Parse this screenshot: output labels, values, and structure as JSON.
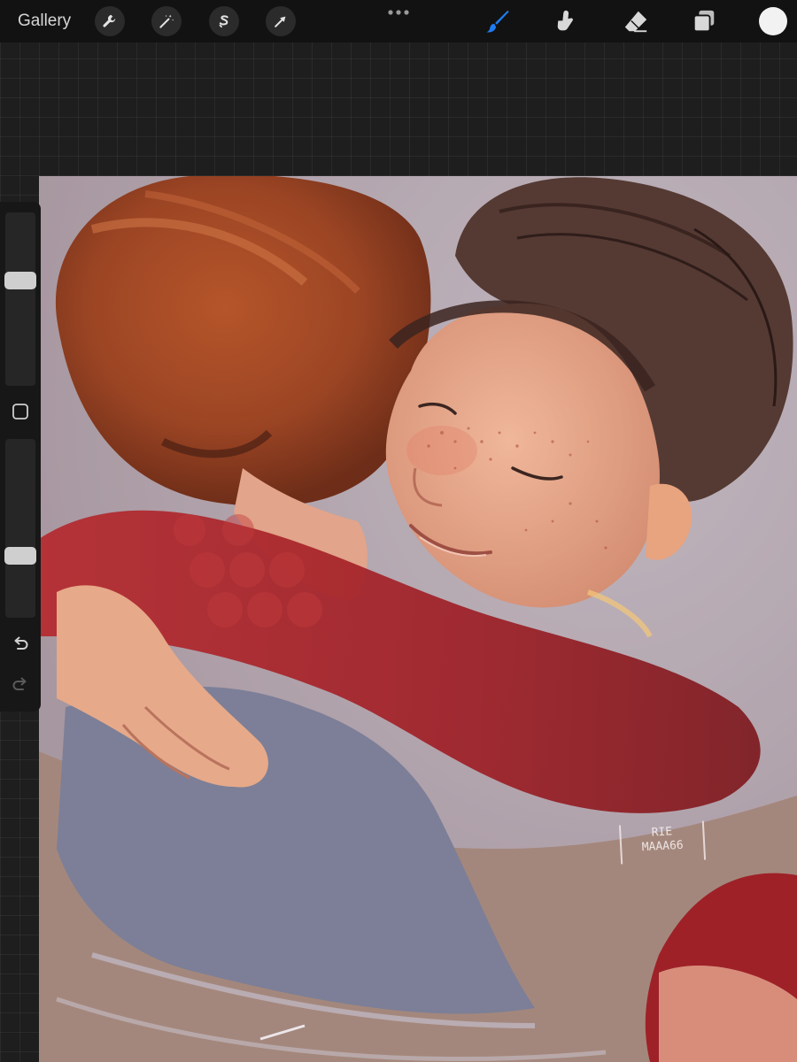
{
  "app": {
    "gallery_label": "Gallery"
  },
  "toolbar": {
    "left_tools": [
      {
        "name": "actions",
        "icon": "wrench-icon"
      },
      {
        "name": "adjustments",
        "icon": "magic-wand-icon"
      },
      {
        "name": "selection",
        "icon": "selection-s-icon"
      },
      {
        "name": "transform",
        "icon": "arrow-cursor-icon"
      }
    ],
    "more_icon": "more-dots-icon",
    "paint_tools": [
      {
        "name": "brush",
        "icon": "brush-icon",
        "active": true
      },
      {
        "name": "smudge",
        "icon": "smudge-finger-icon",
        "active": false
      },
      {
        "name": "eraser",
        "icon": "eraser-icon",
        "active": false
      },
      {
        "name": "layers",
        "icon": "layers-icon",
        "active": false
      }
    ],
    "active_color": "#f2f2f2",
    "accent_color": "#1e7cf2"
  },
  "sidebar": {
    "brush_size_level": 0.62,
    "brush_opacity_level": 0.33,
    "modify_icon": "square-modify-icon",
    "undo_icon": "undo-icon",
    "redo_icon": "redo-icon"
  },
  "artwork": {
    "signature_lines": [
      "RIE",
      "MAAA66"
    ]
  }
}
